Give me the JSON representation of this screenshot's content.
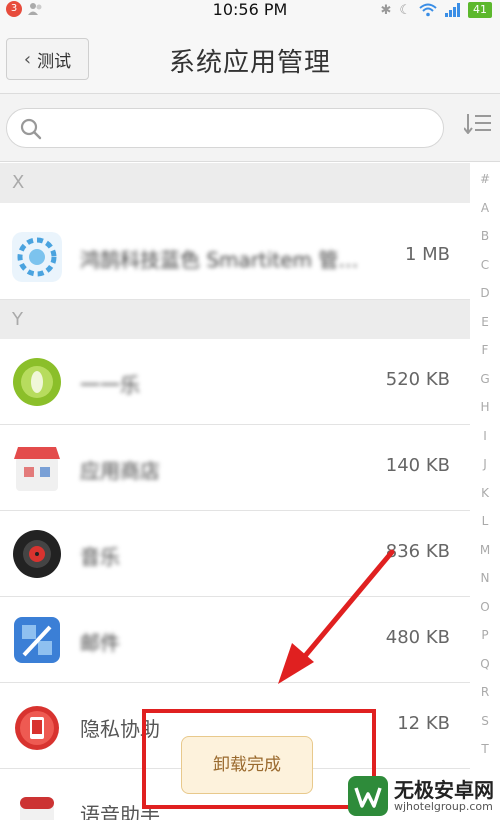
{
  "statusbar": {
    "notification_count": "3",
    "time": "10:56 PM",
    "battery": "41"
  },
  "header": {
    "back_label": "测试",
    "title": "系统应用管理"
  },
  "search": {
    "placeholder": ""
  },
  "sections": [
    {
      "letter": "X",
      "items": [
        {
          "name": "鸿鹄科技蓝色 Smartitem 管…",
          "size": "1 MB",
          "icon": "blue-gear-icon",
          "icon_color": "#4aa3df"
        }
      ]
    },
    {
      "letter": "Y",
      "items": [
        {
          "name": "一一乐",
          "size": "520 KB",
          "icon": "green-circle-icon",
          "icon_color": "#8bbf2a"
        },
        {
          "name": "应用商店",
          "size": "140 KB",
          "icon": "red-store-icon",
          "icon_color": "#e34b4b"
        },
        {
          "name": "音乐",
          "size": "836 KB",
          "icon": "music-disc-icon",
          "icon_color": "#222222"
        },
        {
          "name": "邮件",
          "size": "480 KB",
          "icon": "blue-app-icon",
          "icon_color": "#3b7fd6"
        },
        {
          "name": "隐私协助",
          "size": "12 KB",
          "icon": "robot-phone-icon",
          "icon_color": "#d8332f"
        },
        {
          "name": "语音助手",
          "size": "",
          "icon": "pill-icon",
          "icon_color": "#cc3333"
        }
      ]
    }
  ],
  "index_letters": [
    "#",
    "A",
    "B",
    "C",
    "D",
    "E",
    "F",
    "G",
    "H",
    "I",
    "J",
    "K",
    "L",
    "M",
    "N",
    "O",
    "P",
    "Q",
    "R",
    "S",
    "T"
  ],
  "toast": {
    "message": "卸载完成"
  },
  "watermark": {
    "title": "无极安卓网",
    "url": "wjhotelgroup.com"
  },
  "colors": {
    "annotation_red": "#e02020",
    "toast_bg": "#fdf2dc"
  }
}
